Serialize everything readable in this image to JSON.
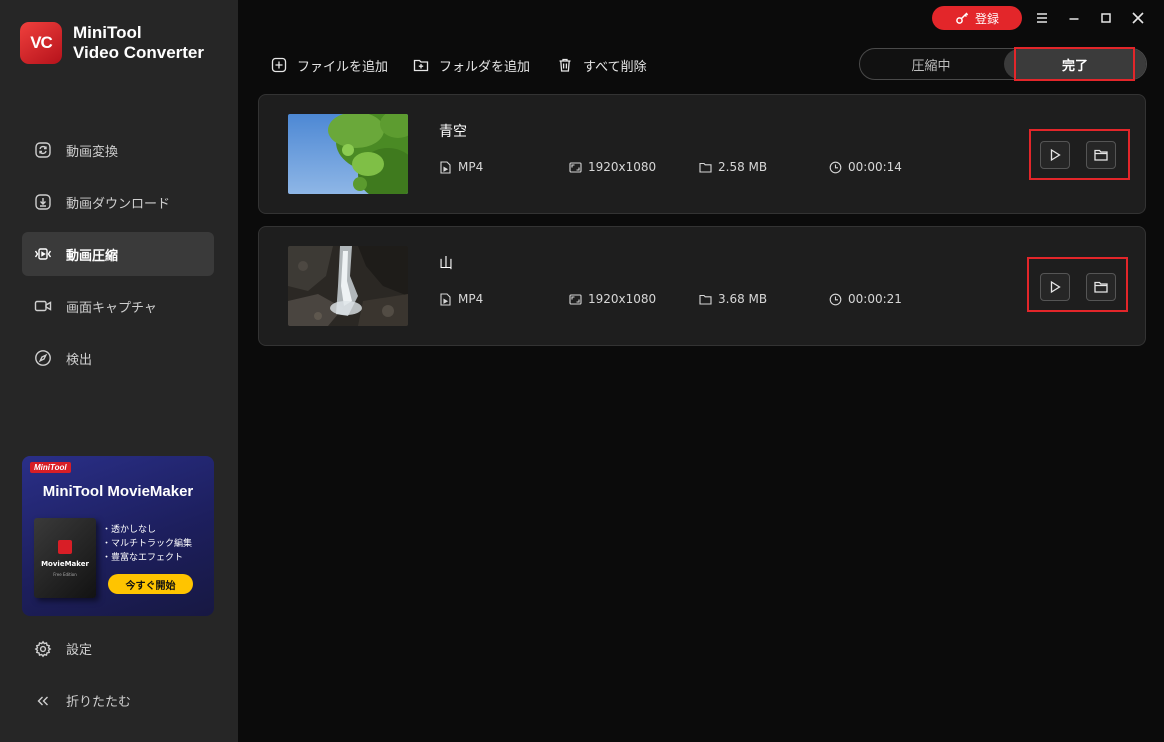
{
  "app": {
    "name_line1": "MiniTool",
    "name_line2": "Video Converter",
    "logo_text": "VC"
  },
  "titlebar": {
    "register_label": "登録"
  },
  "sidebar": {
    "items": [
      {
        "label": "動画変換",
        "icon": "convert-icon"
      },
      {
        "label": "動画ダウンロード",
        "icon": "download-icon"
      },
      {
        "label": "動画圧縮",
        "icon": "compress-icon",
        "active": true
      },
      {
        "label": "画面キャプチャ",
        "icon": "camera-icon"
      },
      {
        "label": "検出",
        "icon": "compass-icon"
      }
    ],
    "settings_label": "設定",
    "collapse_label": "折りたたむ"
  },
  "promo": {
    "badge": "MiniTool",
    "title": "MiniTool MovieMaker",
    "box_name": "MovieMaker",
    "box_sub": "Free Edition",
    "features": [
      "・透かしなし",
      "・マルチトラック編集",
      "・豊富なエフェクト"
    ],
    "cta": "今すぐ開始"
  },
  "toolbar": {
    "add_file": "ファイルを追加",
    "add_folder": "フォルダを追加",
    "delete_all": "すべて削除"
  },
  "tabs": {
    "compressing": "圧縮中",
    "done": "完了"
  },
  "files": [
    {
      "name": "青空",
      "format": "MP4",
      "resolution": "1920x1080",
      "size": "2.58 MB",
      "duration": "00:00:14"
    },
    {
      "name": "山",
      "format": "MP4",
      "resolution": "1920x1080",
      "size": "3.68 MB",
      "duration": "00:00:21"
    }
  ],
  "colors": {
    "accent_red": "#e3262a",
    "sidebar_bg": "#262626",
    "main_bg": "#0b0b0b",
    "card_bg": "#1e1e1e",
    "promo_cta": "#ffc400"
  }
}
